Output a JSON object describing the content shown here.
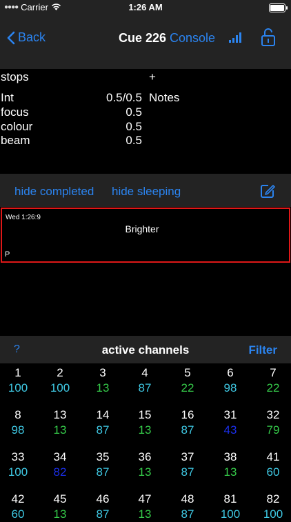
{
  "status_bar": {
    "carrier": "Carrier",
    "time": "1:26 AM"
  },
  "nav": {
    "back_label": "Back",
    "title": "Cue 226",
    "console_label": "Console"
  },
  "params": {
    "header_label": "stops",
    "header_value": "+",
    "rows": [
      {
        "label": "Int",
        "value": "0.5/0.5",
        "note": "Notes"
      },
      {
        "label": "focus",
        "value": "0.5",
        "note": ""
      },
      {
        "label": "colour",
        "value": "0.5",
        "note": ""
      },
      {
        "label": "beam",
        "value": "0.5",
        "note": ""
      }
    ]
  },
  "toolbar": {
    "hide_completed": "hide completed",
    "hide_sleeping": "hide sleeping"
  },
  "note_card": {
    "date": "Wed 1:26:9",
    "text": "Brighter",
    "mark": "P"
  },
  "channels": {
    "help_label": "?",
    "heading": "active channels",
    "filter_label": "Filter",
    "colors": {
      "cyan": "#3fc9e4",
      "green": "#35c949",
      "blue": "#1a2ee8"
    },
    "items": [
      {
        "channel": "1",
        "level": "100",
        "color": "cyan"
      },
      {
        "channel": "2",
        "level": "100",
        "color": "cyan"
      },
      {
        "channel": "3",
        "level": "13",
        "color": "green"
      },
      {
        "channel": "4",
        "level": "87",
        "color": "cyan"
      },
      {
        "channel": "5",
        "level": "22",
        "color": "green"
      },
      {
        "channel": "6",
        "level": "98",
        "color": "cyan"
      },
      {
        "channel": "7",
        "level": "22",
        "color": "green"
      },
      {
        "channel": "8",
        "level": "98",
        "color": "cyan"
      },
      {
        "channel": "13",
        "level": "13",
        "color": "green"
      },
      {
        "channel": "14",
        "level": "87",
        "color": "cyan"
      },
      {
        "channel": "15",
        "level": "13",
        "color": "green"
      },
      {
        "channel": "16",
        "level": "87",
        "color": "cyan"
      },
      {
        "channel": "31",
        "level": "43",
        "color": "blue"
      },
      {
        "channel": "32",
        "level": "79",
        "color": "green"
      },
      {
        "channel": "33",
        "level": "100",
        "color": "cyan"
      },
      {
        "channel": "34",
        "level": "82",
        "color": "blue"
      },
      {
        "channel": "35",
        "level": "87",
        "color": "cyan"
      },
      {
        "channel": "36",
        "level": "13",
        "color": "green"
      },
      {
        "channel": "37",
        "level": "87",
        "color": "cyan"
      },
      {
        "channel": "38",
        "level": "13",
        "color": "green"
      },
      {
        "channel": "41",
        "level": "60",
        "color": "cyan"
      },
      {
        "channel": "42",
        "level": "60",
        "color": "cyan"
      },
      {
        "channel": "45",
        "level": "13",
        "color": "green"
      },
      {
        "channel": "46",
        "level": "87",
        "color": "cyan"
      },
      {
        "channel": "47",
        "level": "13",
        "color": "green"
      },
      {
        "channel": "48",
        "level": "87",
        "color": "cyan"
      },
      {
        "channel": "81",
        "level": "100",
        "color": "cyan"
      },
      {
        "channel": "82",
        "level": "100",
        "color": "cyan"
      }
    ]
  }
}
